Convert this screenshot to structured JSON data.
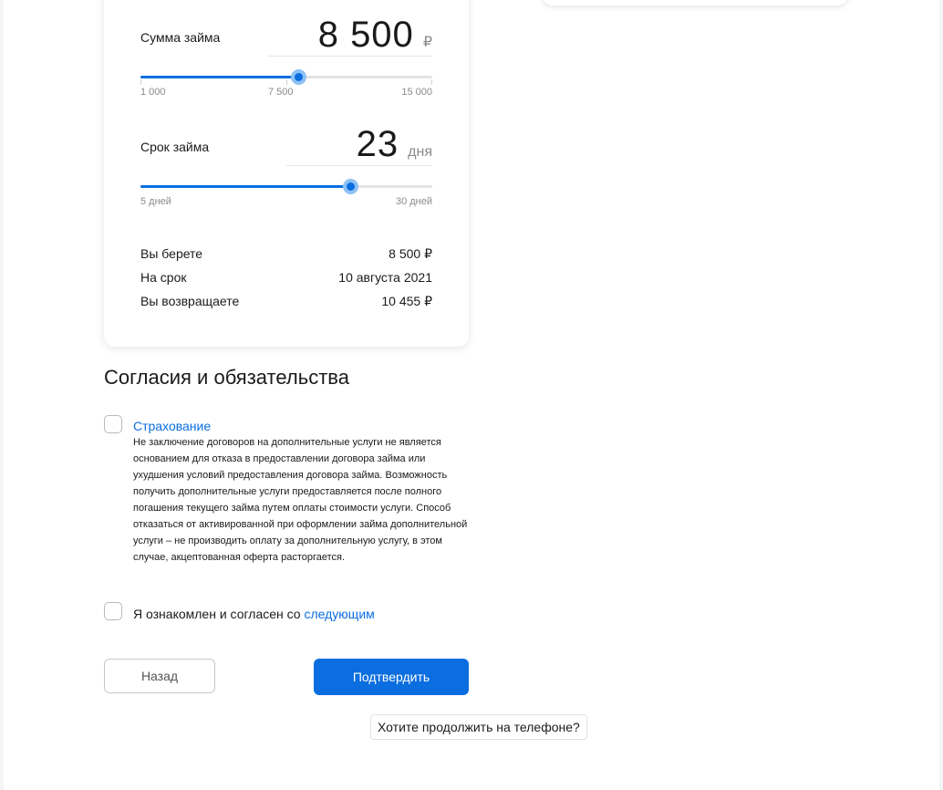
{
  "calculator": {
    "amount": {
      "label": "Сумма займа",
      "value": "8 500",
      "unit": "₽",
      "slider_fraction": 0.54,
      "ticks": [
        "1 000",
        "7 500",
        "15 000"
      ]
    },
    "term": {
      "label": "Срок займа",
      "value": "23",
      "unit": "дня",
      "slider_fraction": 0.72,
      "ticks": [
        "5 дней",
        "30 дней"
      ]
    },
    "summary": [
      {
        "label": "Вы берете",
        "value": "8 500 ₽"
      },
      {
        "label": "На срок",
        "value": "10 августа 2021"
      },
      {
        "label": "Вы возвращаете",
        "value": "10 455 ₽"
      }
    ]
  },
  "consents": {
    "title": "Согласия и обязательства",
    "insurance": {
      "link": "Страхование",
      "text": "Не заключение договоров на дополнительные услуги не является основанием для отказа в предоставлении договора займа или ухудшения условий предоставления договора займа. Возможность получить дополнительные услуги предоставляется после полного погашения текущего займа путем оплаты стоимости услуги. Способ отказаться от активированной при оформлении займа дополнительной услуги – не производить оплату за дополнительную услугу, в этом случае, акцептованная оферта расторгается."
    },
    "agree": {
      "prefix": "Я ознакомлен и согласен со ",
      "link": "следующим"
    }
  },
  "buttons": {
    "back": "Назад",
    "confirm": "Подтвердить",
    "phone": "Хотите продолжить на телефоне?"
  },
  "colors": {
    "accent": "#0a6ee0"
  }
}
